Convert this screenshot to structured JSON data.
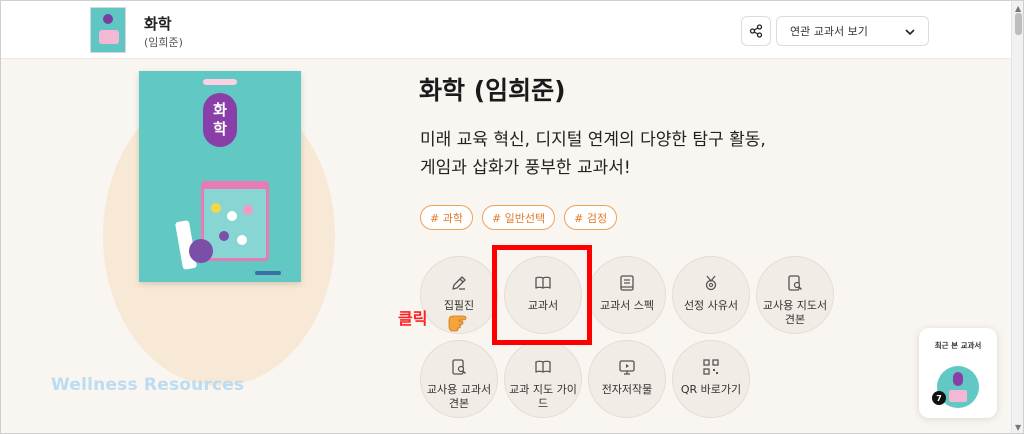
{
  "header": {
    "title": "화학",
    "subtitle": "(임희준)",
    "related_select": "연관 교과서 보기"
  },
  "book": {
    "title": "화학 (임희준)",
    "desc_line1": "미래 교육 혁신, 디지털 연계의 다양한 탐구 활동,",
    "desc_line2": "게임과 삽화가 풍부한 교과서!",
    "cover_badge_1": "화",
    "cover_badge_2": "학",
    "tags": [
      "# 과학",
      "# 일반선택",
      "# 검정"
    ]
  },
  "actions": [
    {
      "label": "집필진",
      "icon": "pen-icon"
    },
    {
      "label": "교과서",
      "icon": "book-open-icon"
    },
    {
      "label": "교과서 스펙",
      "icon": "spec-book-icon"
    },
    {
      "label": "선정 사유서",
      "icon": "medal-icon"
    },
    {
      "label": "교사용 지도서 견본",
      "icon": "doc-search-icon"
    },
    {
      "label": "교사용 교과서 견본",
      "icon": "doc-search-icon"
    },
    {
      "label": "교과 지도 가이드",
      "icon": "book-open-icon"
    },
    {
      "label": "전자저작물",
      "icon": "monitor-icon"
    },
    {
      "label": "QR 바로가기",
      "icon": "qr-icon"
    }
  ],
  "annotation": {
    "click_label": "클릭"
  },
  "watermark": "Wellness Resources",
  "recent": {
    "title": "최근 본 교과서",
    "count": "7"
  },
  "colors": {
    "accent_orange": "#e07a2a",
    "highlight_red": "#ff0000",
    "cover_teal": "#61c8c4",
    "cover_purple": "#8a3fa8"
  }
}
